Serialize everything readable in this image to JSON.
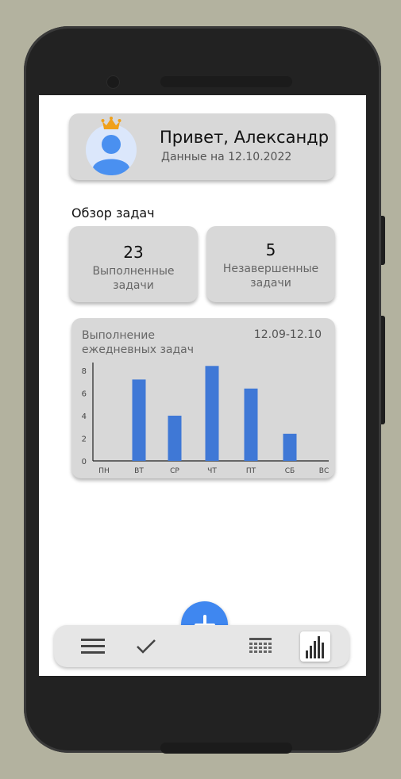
{
  "profile": {
    "greeting": "Привет, Александр",
    "date_line": "Данные на 12.10.2022",
    "avatar_icon": "user-avatar-icon",
    "badge_icon": "crown-icon"
  },
  "overview": {
    "title": "Обзор задач",
    "completed": {
      "count": "23",
      "label": "Выполненные задачи"
    },
    "incomplete": {
      "count": "5",
      "label": "Незавершенные задачи"
    }
  },
  "chart_card": {
    "title": "Выполнение ежедневных задач",
    "range": "12.09-12.10"
  },
  "chart_data": {
    "type": "bar",
    "title": "Выполнение ежедневных задач",
    "categories": [
      "ПН",
      "ВТ",
      "СР",
      "ЧТ",
      "ПТ",
      "СБ",
      "ВС"
    ],
    "values": [
      0,
      7.2,
      4,
      8.4,
      6.4,
      2.4,
      0
    ],
    "yticks": [
      "0",
      "2",
      "4",
      "6",
      "8"
    ],
    "ylim": [
      0,
      8
    ],
    "grid": false,
    "bar_color": "#3f78d6"
  },
  "nav": {
    "items": [
      {
        "name": "menu",
        "icon": "hamburger-menu-icon"
      },
      {
        "name": "tasks",
        "icon": "checkmark-icon"
      },
      {
        "name": "calendar",
        "icon": "calendar-icon"
      },
      {
        "name": "stats",
        "icon": "bar-chart-icon",
        "active": true
      }
    ],
    "fab_icon": "plus-icon"
  },
  "colors": {
    "accent": "#3f87f0",
    "card": "#d8d8d8",
    "crown": "#f0a019",
    "avatar": "#4a90f0"
  }
}
